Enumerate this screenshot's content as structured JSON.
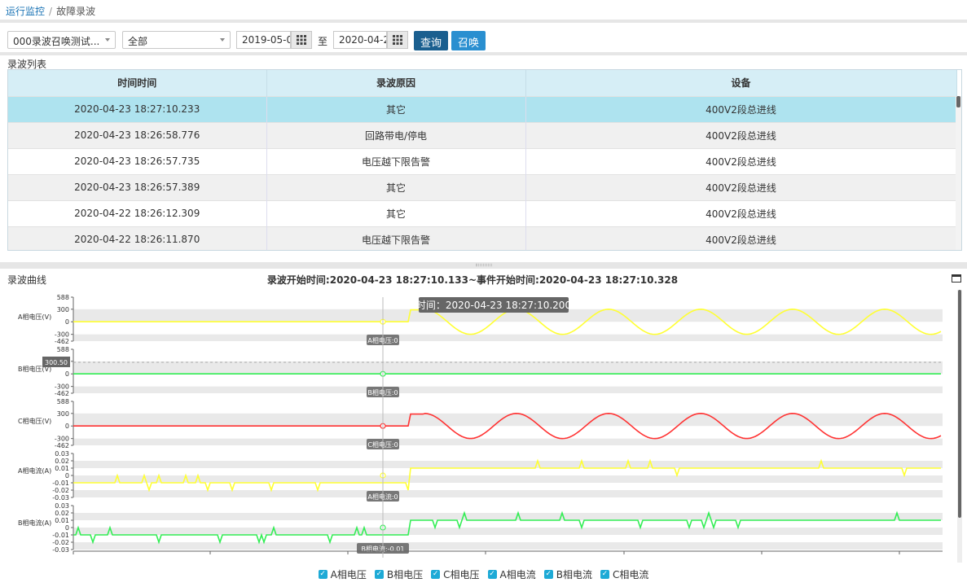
{
  "breadcrumb": {
    "parent": "运行监控",
    "separator": "/",
    "current": "故障录波"
  },
  "toolbar": {
    "device_select": "000录波召唤测试...",
    "type_select": "全部",
    "start_date": "2019-05-0",
    "to_label": "至",
    "end_date": "2020-04-2",
    "query_label": "查询",
    "call_label": "召唤"
  },
  "list": {
    "title": "录波列表",
    "columns": [
      "时间时间",
      "录波原因",
      "设备"
    ],
    "rows": [
      [
        "2020-04-23 18:27:10.233",
        "其它",
        "400V2段总进线"
      ],
      [
        "2020-04-23 18:26:58.776",
        "回路带电/停电",
        "400V2段总进线"
      ],
      [
        "2020-04-23 18:26:57.735",
        "电压越下限告警",
        "400V2段总进线"
      ],
      [
        "2020-04-23 18:26:57.389",
        "其它",
        "400V2段总进线"
      ],
      [
        "2020-04-22 18:26:12.309",
        "其它",
        "400V2段总进线"
      ],
      [
        "2020-04-22 18:26:11.870",
        "电压越下限告警",
        "400V2段总进线"
      ]
    ]
  },
  "curve": {
    "section_title": "录波曲线",
    "header": "录波开始时间:2020-04-23 18:27:10.133~事件开始时间:2020-04-23 18:27:10.328",
    "tooltip": "时间：2020-04-23 18:27:10.200",
    "pointer_value": "300.50"
  },
  "chart_data": {
    "type": "line",
    "panels": [
      {
        "name": "A相电压(V)",
        "ticks": [
          "588",
          "300",
          "0",
          "-300",
          "-462"
        ],
        "ylim": [
          -462,
          588
        ],
        "color": "#ffff33",
        "cursor_label": "A相电压:0",
        "kind": "sine",
        "amplitude": 300
      },
      {
        "name": "B相电压(V)",
        "ticks": [
          "588",
          "300",
          "0",
          "-300",
          "-462"
        ],
        "ylim": [
          -462,
          588
        ],
        "color": "#33ee55",
        "cursor_label": "B相电压:0",
        "kind": "flat",
        "amplitude": 0
      },
      {
        "name": "C相电压(V)",
        "ticks": [
          "588",
          "300",
          "0",
          "-300",
          "-462"
        ],
        "ylim": [
          -462,
          588
        ],
        "color": "#ff3333",
        "cursor_label": "C相电压:0",
        "kind": "sine",
        "amplitude": 300
      },
      {
        "name": "A相电流(A)",
        "ticks": [
          "0.03",
          "0.02",
          "0.01",
          "0",
          "-0.01",
          "-0.02",
          "-0.03"
        ],
        "ylim": [
          -0.03,
          0.03
        ],
        "color": "#ffff33",
        "cursor_label": "A相电流:0",
        "kind": "noise",
        "pre": -0.01,
        "post": 0.01
      },
      {
        "name": "B相电流(A)",
        "ticks": [
          "0.03",
          "0.02",
          "0.01",
          "0",
          "-0.01",
          "-0.02",
          "-0.03"
        ],
        "ylim": [
          -0.03,
          0.03
        ],
        "color": "#33ee55",
        "cursor_label": "B相电流:-0.01",
        "kind": "noise",
        "pre": -0.01,
        "post": 0.01
      }
    ],
    "legend": [
      "A相电压",
      "B相电压",
      "C相电压",
      "A相电流",
      "B相电流",
      "C相电流"
    ]
  }
}
